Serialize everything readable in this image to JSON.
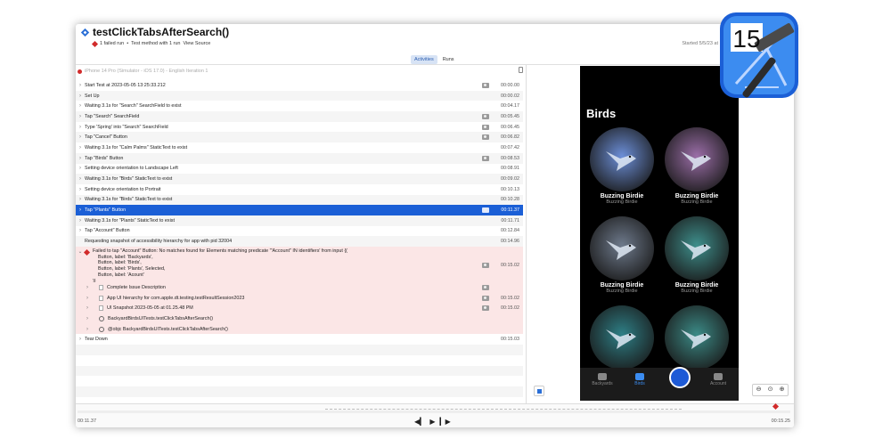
{
  "header": {
    "title": "testClickTabsAfterSearch()",
    "subtitle_failed": "1 failed run",
    "subtitle_sep": "•",
    "subtitle_method": "Test method with 1 run",
    "view_source": "View Source",
    "started": "Started 5/5/23 at"
  },
  "tabs": [
    {
      "label": "Activities",
      "active": true
    },
    {
      "label": "Runs",
      "active": false
    }
  ],
  "device": "iPhone 14 Pro (Simulator - iOS 17.0) - English Iteration 1",
  "rows": [
    {
      "label": "Start Test at 2023-05-05 13:25:33.212",
      "time": "00:00.00",
      "attach": true
    },
    {
      "label": "Set Up",
      "time": "00:00.02",
      "attach": false
    },
    {
      "label": "Waiting 3.1s for \"Search\" SearchField to exist",
      "time": "00:04.17",
      "attach": false
    },
    {
      "label": "Tap \"Search\" SearchField",
      "time": "00:05.45",
      "attach": true
    },
    {
      "label": "Type 'Spring' into \"Search\" SearchField",
      "time": "00:06.45",
      "attach": true
    },
    {
      "label": "Tap \"Cancel\" Button",
      "time": "00:06.82",
      "attach": true
    },
    {
      "label": "Waiting 3.1s for \"Calm Palms\" StaticText to exist",
      "time": "00:07.42",
      "attach": false
    },
    {
      "label": "Tap \"Birds\" Button",
      "time": "00:08.53",
      "attach": true
    },
    {
      "label": "Setting device orientation to Landscape Left",
      "time": "00:08.91",
      "attach": false
    },
    {
      "label": "Waiting 3.1s for \"Birds\" StaticText to exist",
      "time": "00:09.02",
      "attach": false
    },
    {
      "label": "Setting device orientation to Portrait",
      "time": "00:10.13",
      "attach": false
    },
    {
      "label": "Waiting 3.1s for \"Birds\" StaticText to exist",
      "time": "00:10.28",
      "attach": false
    },
    {
      "label": "Tap \"Plants\" Button",
      "time": "00:11.37",
      "attach": true,
      "selected": true
    },
    {
      "label": "Waiting 3.1s for \"Plants\" StaticText to exist",
      "time": "00:11.71",
      "attach": false
    },
    {
      "label": "Tap \"Account\" Button",
      "time": "00:12.84",
      "attach": false
    },
    {
      "label": "Requesting snapshot of accessibility hierarchy for app with pid 32004",
      "time": "00:14.96",
      "attach": false,
      "nochev": true
    }
  ],
  "error": {
    "label": "Failed to tap \"Account\" Button: No matches found for Elements matching predicate '\"Account\" IN identifiers' from input {(\n    Button, label: 'Backyards',\n    Button, label: 'Birds',\n    Button, label: 'Plants', Selected,\n    Button, label: 'Acount'\n)}",
    "time": "00:15.02"
  },
  "error_subs": [
    {
      "label": "Complete Issue Description",
      "time": "",
      "attach": true,
      "icon": "doc"
    },
    {
      "label": "App UI hierarchy for com.apple.dt.testing.testResultSession2023",
      "time": "00:15.02",
      "attach": true,
      "icon": "doc"
    },
    {
      "label": "UI Snapshot 2023-05-05 at 01.25.48 PM",
      "time": "00:15.02",
      "attach": true,
      "icon": "doc"
    },
    {
      "label": "BackyardBirdsUITests.testClickTabsAfterSearch()",
      "time": "",
      "attach": false,
      "icon": "gear"
    },
    {
      "label": "@objc BackyardBirdsUITests.testClickTabsAfterSearch()",
      "time": "",
      "attach": false,
      "icon": "gear"
    }
  ],
  "teardown": {
    "label": "Tear Down",
    "time": "00:15.03"
  },
  "phone": {
    "title": "Birds",
    "birds": [
      {
        "name": "Buzzing Birdie",
        "sub": "Buzzing Birdie",
        "color": "#6c8fd8"
      },
      {
        "name": "Buzzing Birdie",
        "sub": "Buzzing Birdie",
        "color": "#9b6ea8"
      },
      {
        "name": "Buzzing Birdie",
        "sub": "Buzzing Birdie",
        "color": "#6e7a8c"
      },
      {
        "name": "Buzzing Birdie",
        "sub": "Buzzing Birdie",
        "color": "#3e8f8c"
      },
      {
        "name": "Buzzing Birdie",
        "sub": "Buzzing Birdie",
        "color": "#2e7f86"
      },
      {
        "name": "Buzzing Birdie",
        "sub": "Buzzing Birdie",
        "color": "#3b8a86"
      }
    ],
    "tabs": [
      {
        "label": "Backyards",
        "active": false
      },
      {
        "label": "Birds",
        "active": true
      },
      {
        "label": "Plants",
        "active": false
      },
      {
        "label": "Account",
        "active": false
      }
    ]
  },
  "timeline": {
    "start": "00:11.37",
    "end": "00:15.25"
  },
  "xcode": {
    "version": "15"
  },
  "colors": {
    "accent": "#1b5fd6",
    "error_bg": "#fbe6e6",
    "fail": "#d12b2b"
  }
}
